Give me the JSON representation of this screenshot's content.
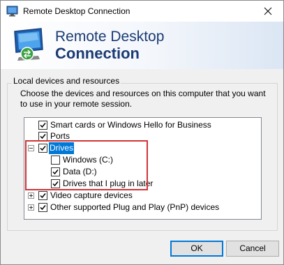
{
  "window": {
    "title": "Remote Desktop Connection",
    "close_icon": "close-icon"
  },
  "banner": {
    "title_line1": "Remote Desktop",
    "title_line2": "Connection"
  },
  "group": {
    "legend": "Local devices and resources",
    "description": "Choose the devices and resources on this computer that you want to use in your remote session."
  },
  "tree": {
    "items": [
      {
        "label": "Smart cards or Windows Hello for Business",
        "checked": true
      },
      {
        "label": "Ports",
        "checked": true
      },
      {
        "label": "Drives",
        "checked": true,
        "expanded": true,
        "selected": true
      },
      {
        "label": "Windows (C:)",
        "checked": false
      },
      {
        "label": "Data (D:)",
        "checked": true
      },
      {
        "label": "Drives that I plug in later",
        "checked": true
      },
      {
        "label": "Video capture devices",
        "checked": true,
        "expanded": false
      },
      {
        "label": "Other supported Plug and Play (PnP) devices",
        "checked": true,
        "expanded": false
      }
    ]
  },
  "buttons": {
    "ok": "OK",
    "cancel": "Cancel"
  },
  "colors": {
    "accent": "#0078d7",
    "highlight_border": "#d13438",
    "banner_text": "#1a3b73"
  }
}
